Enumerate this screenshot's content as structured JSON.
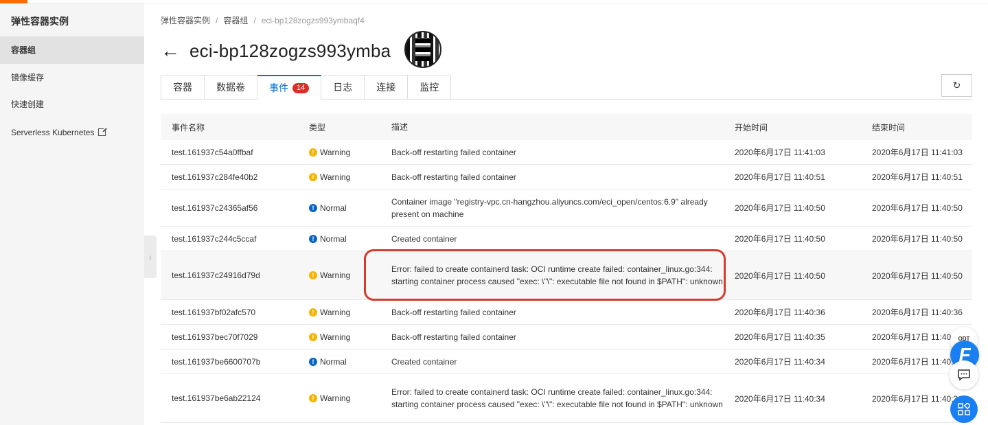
{
  "sidebar": {
    "title": "弹性容器实例",
    "items": [
      {
        "label": "容器组"
      },
      {
        "label": "镜像缓存"
      },
      {
        "label": "快速创建"
      },
      {
        "label": "Serverless Kubernetes"
      }
    ]
  },
  "breadcrumb": [
    "弹性容器实例",
    "容器组",
    "eci-bp128zogzs993ymbaqf4"
  ],
  "page": {
    "title": "eci-bp128zogzs993ymba"
  },
  "tabs": [
    {
      "label": "容器"
    },
    {
      "label": "数据卷"
    },
    {
      "label": "事件",
      "badge": "14"
    },
    {
      "label": "日志"
    },
    {
      "label": "连接"
    },
    {
      "label": "监控"
    }
  ],
  "table": {
    "headers": [
      "事件名称",
      "类型",
      "描述",
      "开始时间",
      "结束时间"
    ],
    "rows": [
      {
        "name": "test.161937c54a0ffbaf",
        "type": "Warning",
        "desc": "Back-off restarting failed container",
        "start": "2020年6月17日 11:41:03",
        "end": "2020年6月17日 11:41:03"
      },
      {
        "name": "test.161937c284fe40b2",
        "type": "Warning",
        "desc": "Back-off restarting failed container",
        "start": "2020年6月17日 11:40:51",
        "end": "2020年6月17日 11:40:51"
      },
      {
        "name": "test.161937c24365af56",
        "type": "Normal",
        "desc": "Container image \"registry-vpc.cn-hangzhou.aliyuncs.com/eci_open/centos:6.9\" already present on machine",
        "start": "2020年6月17日 11:40:50",
        "end": "2020年6月17日 11:40:50"
      },
      {
        "name": "test.161937c244c5ccaf",
        "type": "Normal",
        "desc": "Created container",
        "start": "2020年6月17日 11:40:50",
        "end": "2020年6月17日 11:40:50"
      },
      {
        "name": "test.161937c24916d79d",
        "type": "Warning",
        "desc": "Error: failed to create containerd task: OCI runtime create failed: container_linux.go:344: starting container process caused \"exec: \\\"\\\": executable file not found in $PATH\": unknown",
        "start": "2020年6月17日 11:40:50",
        "end": "2020年6月17日 11:40:50"
      },
      {
        "name": "test.161937bf02afc570",
        "type": "Warning",
        "desc": "Back-off restarting failed container",
        "start": "2020年6月17日 11:40:36",
        "end": "2020年6月17日 11:40:36"
      },
      {
        "name": "test.161937bec70f7029",
        "type": "Warning",
        "desc": "Back-off restarting failed container",
        "start": "2020年6月17日 11:40:35",
        "end": "2020年6月17日 11:40:35"
      },
      {
        "name": "test.161937be6600707b",
        "type": "Normal",
        "desc": "Created container",
        "start": "2020年6月17日 11:40:34",
        "end": "2020年6月17日 11:40:34"
      },
      {
        "name": "test.161937be6ab22124",
        "type": "Warning",
        "desc": "Error: failed to create containerd task: OCI runtime create failed: container_linux.go:344: starting container process caused \"exec: \\\"\\\": executable file not found in $PATH\": unknown",
        "start": "2020年6月17日 11:40:34",
        "end": "2020年6月17日 11:40:34"
      }
    ]
  },
  "floating": {
    "odt": "ODT",
    "f_logo": "F"
  },
  "colors": {
    "accent": "#ff6a00",
    "link": "#0070cc",
    "warning": "#f5b400",
    "normal": "#0a64c8",
    "badge": "#d93026",
    "annotation": "#d63a2e"
  },
  "icons": {
    "back": "back-arrow-icon",
    "refresh": "refresh-icon",
    "external": "external-link-icon",
    "warning": "warning-icon",
    "normal": "info-icon",
    "chat": "chat-icon",
    "apps": "apps-grid-icon"
  }
}
